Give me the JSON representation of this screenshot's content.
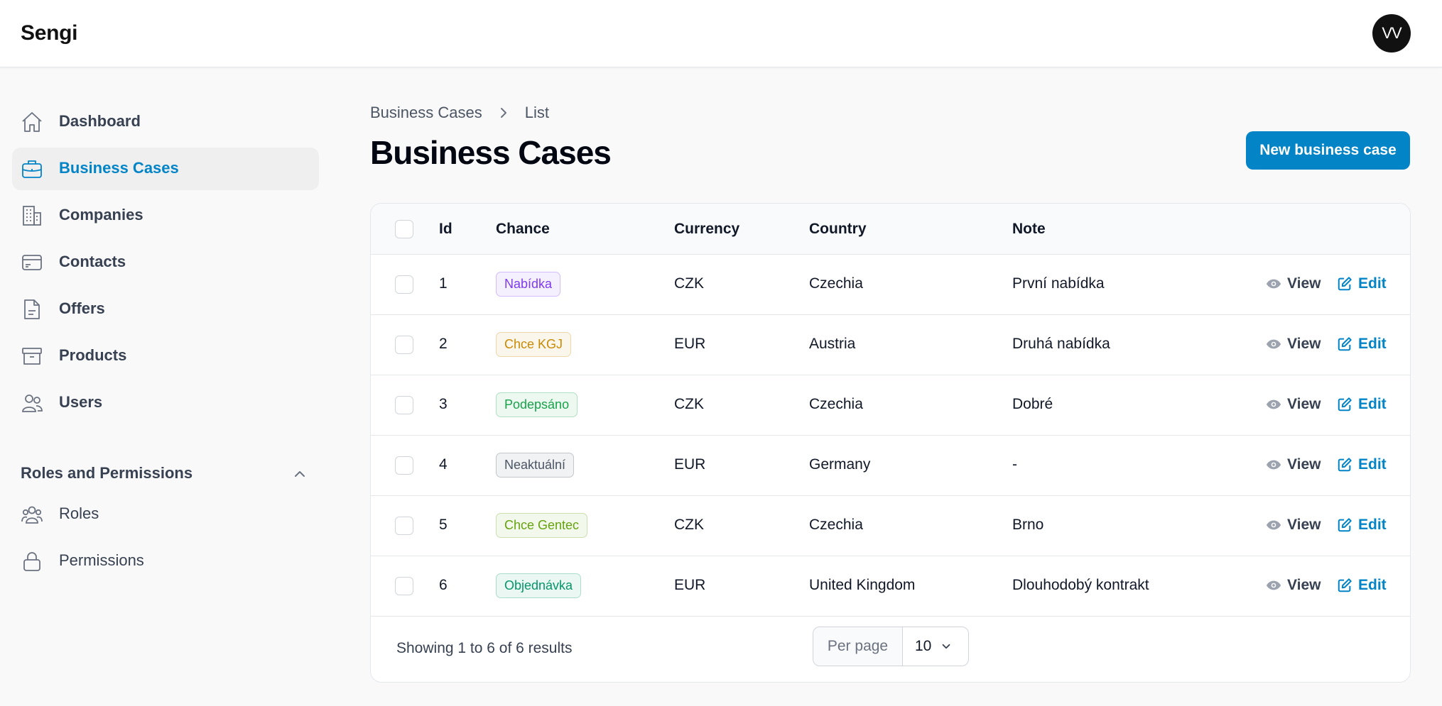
{
  "app": {
    "brand": "Sengi",
    "user_initials": "VV"
  },
  "sidebar": {
    "items": [
      {
        "label": "Dashboard",
        "icon": "home-icon"
      },
      {
        "label": "Business Cases",
        "icon": "briefcase-icon",
        "active": true
      },
      {
        "label": "Companies",
        "icon": "building-icon"
      },
      {
        "label": "Contacts",
        "icon": "card-icon"
      },
      {
        "label": "Offers",
        "icon": "document-icon"
      },
      {
        "label": "Products",
        "icon": "archive-icon"
      },
      {
        "label": "Users",
        "icon": "users-icon"
      }
    ],
    "group": {
      "title": "Roles and Permissions",
      "items": [
        {
          "label": "Roles",
          "icon": "user-group-icon"
        },
        {
          "label": "Permissions",
          "icon": "lock-icon"
        }
      ]
    }
  },
  "breadcrumb": {
    "root": "Business Cases",
    "current": "List"
  },
  "page": {
    "title": "Business Cases",
    "new_button": "New business case"
  },
  "table": {
    "headers": {
      "id": "Id",
      "chance": "Chance",
      "currency": "Currency",
      "country": "Country",
      "note": "Note"
    },
    "view_label": "View",
    "edit_label": "Edit",
    "rows": [
      {
        "id": "1",
        "chance": "Nabídka",
        "chance_color": "#7e3af2",
        "currency": "CZK",
        "country": "Czechia",
        "note": "První nabídka"
      },
      {
        "id": "2",
        "chance": "Chce KGJ",
        "chance_color": "#ca8a04",
        "currency": "EUR",
        "country": "Austria",
        "note": "Druhá nabídka"
      },
      {
        "id": "3",
        "chance": "Podepsáno",
        "chance_color": "#16a34a",
        "currency": "CZK",
        "country": "Czechia",
        "note": "Dobré"
      },
      {
        "id": "4",
        "chance": "Neaktuální",
        "chance_color": "#4b5563",
        "currency": "EUR",
        "country": "Germany",
        "note": "-"
      },
      {
        "id": "5",
        "chance": "Chce Gentec",
        "chance_color": "#65a30d",
        "currency": "CZK",
        "country": "Czechia",
        "note": "Brno"
      },
      {
        "id": "6",
        "chance": "Objednávka",
        "chance_color": "#059669",
        "currency": "EUR",
        "country": "United Kingdom",
        "note": "Dlouhodobý kontrakt"
      }
    ],
    "footer": {
      "summary": "Showing 1 to 6 of 6 results",
      "per_page_label": "Per page",
      "per_page_value": "10"
    }
  },
  "colors": {
    "accent": "#0284c7",
    "sidebar_active_bg": "#efefef"
  }
}
